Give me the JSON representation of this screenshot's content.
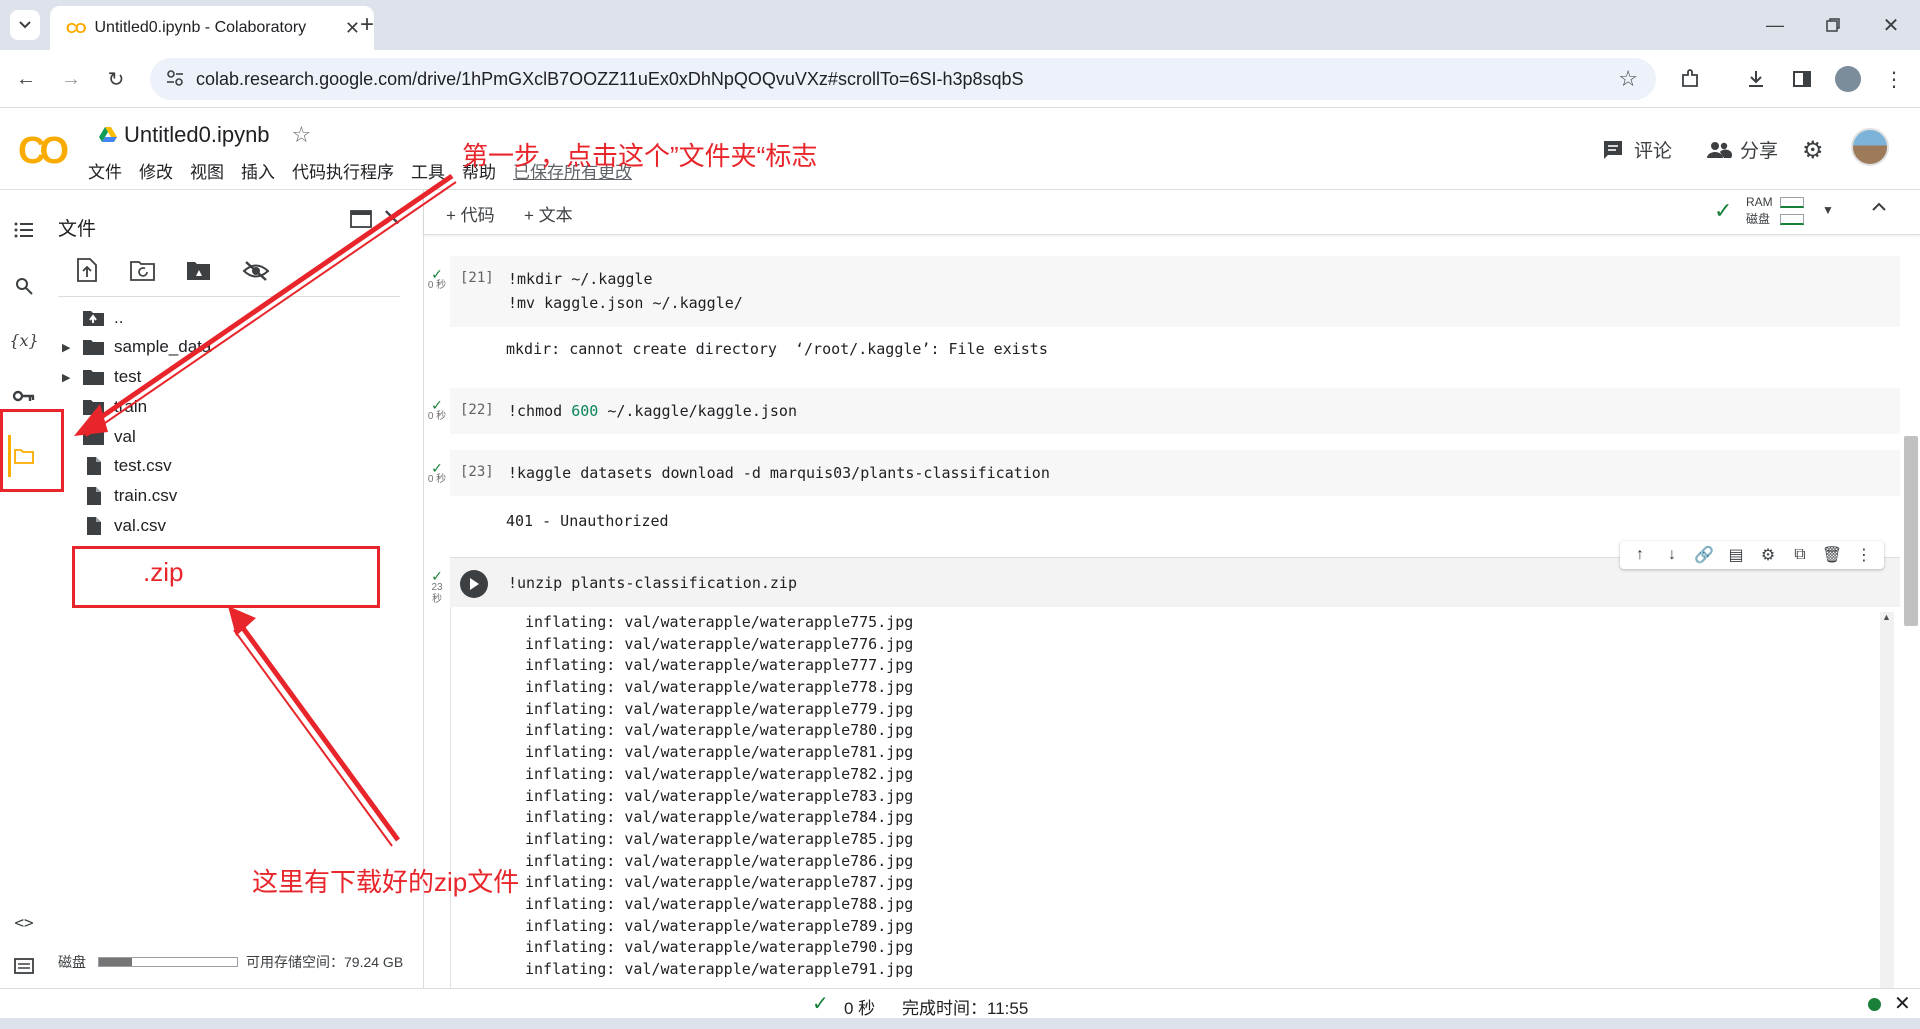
{
  "browser": {
    "tab_title": "Untitled0.ipynb - Colaboratory",
    "favicon_text": "CO",
    "url": "colab.research.google.com/drive/1hPmGXclB7OOZZ11uEx0xDhNpQOQvuVXz#scrollTo=6SI-h3p8sqbS"
  },
  "colab": {
    "logo_text": "CO",
    "notebook_title": "Untitled0.ipynb",
    "menu": [
      "文件",
      "修改",
      "视图",
      "插入",
      "代码执行程序",
      "工具",
      "帮助"
    ],
    "saved_status": "已保存所有更改",
    "comment_label": "评论",
    "share_label": "分享",
    "add_code_label": "+ 代码",
    "add_text_label": "+ 文本",
    "ram_label": "RAM",
    "disk_label": "磁盘"
  },
  "file_panel": {
    "title": "文件",
    "tree": [
      {
        "name": "..",
        "type": "parent"
      },
      {
        "name": "sample_data",
        "type": "folder"
      },
      {
        "name": "test",
        "type": "folder"
      },
      {
        "name": "train",
        "type": "folder"
      },
      {
        "name": "val",
        "type": "folder"
      },
      {
        "name": "test.csv",
        "type": "file"
      },
      {
        "name": "train.csv",
        "type": "file"
      },
      {
        "name": "val.csv",
        "type": "file"
      }
    ],
    "disk_label": "磁盘",
    "free_space": "可用存储空间：79.24 GB"
  },
  "cells": [
    {
      "number": "[21]",
      "time": "0 秒",
      "code": [
        "!mkdir  ~/.kaggle",
        "!mv  kaggle.json  ~/.kaggle/"
      ],
      "output": "mkdir: cannot create directory  ‘/root/.kaggle’: File exists"
    },
    {
      "number": "[22]",
      "time": "0 秒",
      "code": [
        "!chmod  600  ~/.kaggle/kaggle.json"
      ],
      "output": ""
    },
    {
      "number": "[23]",
      "time": "0 秒",
      "code": [
        "!kaggle  datasets  download  -d  marquis03/plants-classification"
      ],
      "output": "401 - Unauthorized"
    },
    {
      "number": "",
      "time": "23 秒",
      "code": [
        "!unzip  plants-classification.zip"
      ],
      "output": ""
    }
  ],
  "unzip_log": [
    "inflating: val/waterapple/waterapple775.jpg",
    "inflating: val/waterapple/waterapple776.jpg",
    "inflating: val/waterapple/waterapple777.jpg",
    "inflating: val/waterapple/waterapple778.jpg",
    "inflating: val/waterapple/waterapple779.jpg",
    "inflating: val/waterapple/waterapple780.jpg",
    "inflating: val/waterapple/waterapple781.jpg",
    "inflating: val/waterapple/waterapple782.jpg",
    "inflating: val/waterapple/waterapple783.jpg",
    "inflating: val/waterapple/waterapple784.jpg",
    "inflating: val/waterapple/waterapple785.jpg",
    "inflating: val/waterapple/waterapple786.jpg",
    "inflating: val/waterapple/waterapple787.jpg",
    "inflating: val/waterapple/waterapple788.jpg",
    "inflating: val/waterapple/waterapple789.jpg",
    "inflating: val/waterapple/waterapple790.jpg",
    "inflating: val/waterapple/waterapple791.jpg"
  ],
  "status_bar": {
    "duration": "0 秒",
    "completed": "完成时间：11:55"
  },
  "annotations": {
    "step1": "第一步，点击这个”文件夹“标志",
    "zip_box": ".zip",
    "zip_note": "这里有下载好的zip文件"
  },
  "colors": {
    "annotation_red": "#e8252a",
    "colab_orange": "#f9ab00",
    "success_green": "#188038"
  }
}
